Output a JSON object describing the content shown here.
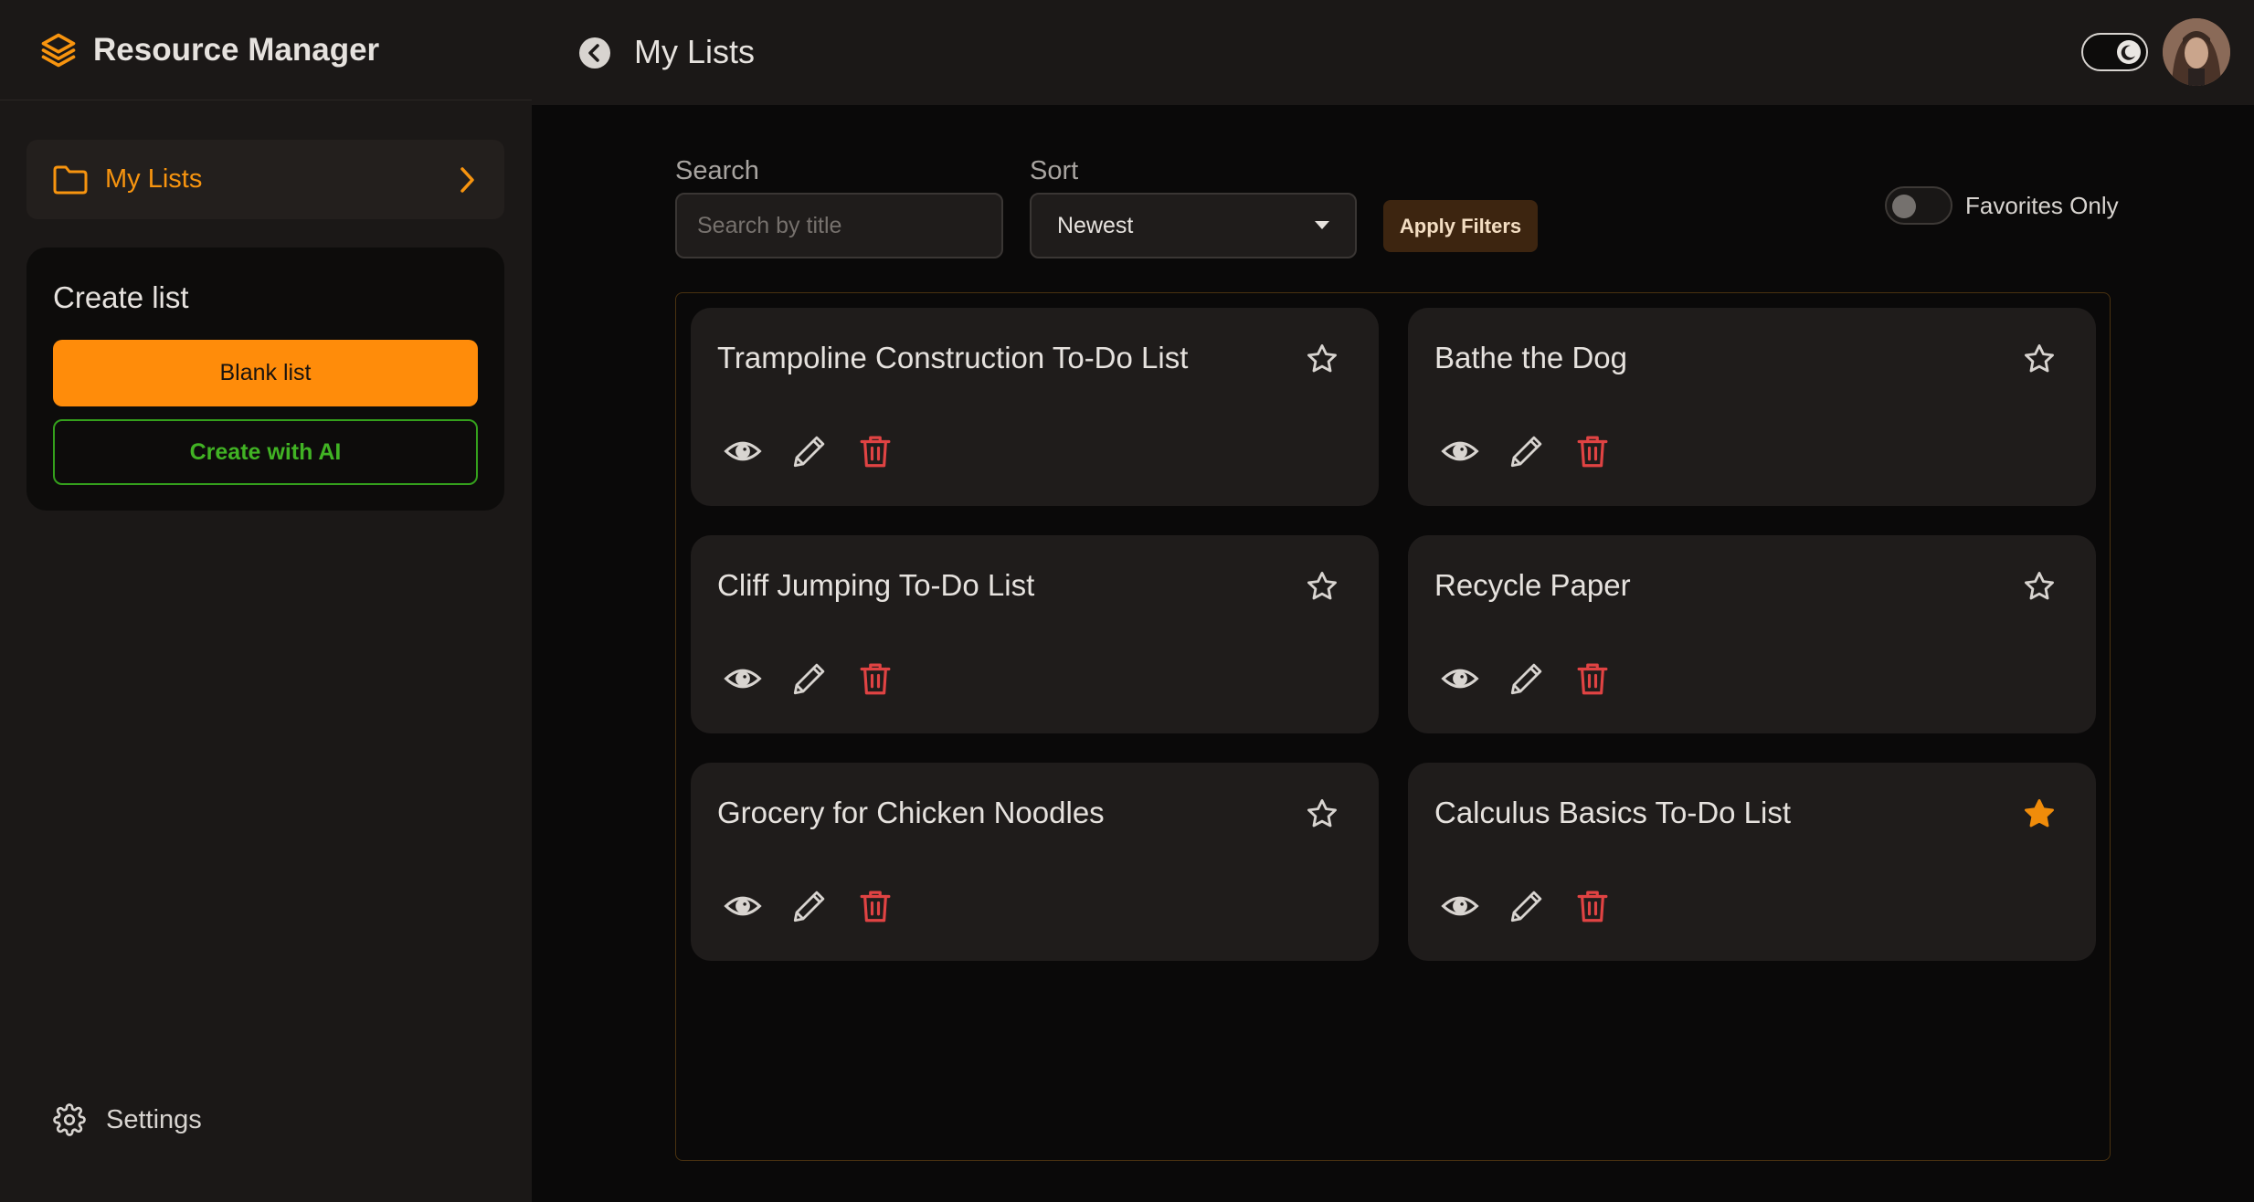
{
  "app": {
    "title": "Resource Manager"
  },
  "sidebar": {
    "nav": {
      "label": "My Lists"
    },
    "create": {
      "heading": "Create list",
      "blank_label": "Blank list",
      "ai_label": "Create with AI"
    },
    "settings_label": "Settings"
  },
  "header": {
    "title": "My Lists",
    "theme_toggle": "dark-mode-toggle"
  },
  "filters": {
    "search_label": "Search",
    "search_placeholder": "Search by title",
    "search_value": "",
    "sort_label": "Sort",
    "sort_value": "Newest",
    "apply_label": "Apply Filters",
    "favorites_label": "Favorites Only",
    "favorites_on": false
  },
  "lists": [
    {
      "title": "Trampoline Construction To-Do List",
      "favorite": false
    },
    {
      "title": "Bathe the Dog",
      "favorite": false
    },
    {
      "title": "Cliff Jumping To-Do List",
      "favorite": false
    },
    {
      "title": "Recycle Paper",
      "favorite": false
    },
    {
      "title": "Grocery for Chicken Noodles",
      "favorite": false
    },
    {
      "title": "Calculus Basics To-Do List",
      "favorite": true
    }
  ],
  "colors": {
    "accent": "#ff8c0a",
    "ai_green": "#41b324",
    "delete_red": "#e04343",
    "star_active": "#f08c0a"
  },
  "icons": {
    "logo": "layers-icon",
    "nav": "folder-icon",
    "nav_arrow": "chevron-right-icon",
    "settings": "gear-icon",
    "back": "back-arrow-icon",
    "card_actions": [
      "eye-icon",
      "pencil-icon",
      "trash-icon"
    ],
    "favorite": "star-icon"
  }
}
